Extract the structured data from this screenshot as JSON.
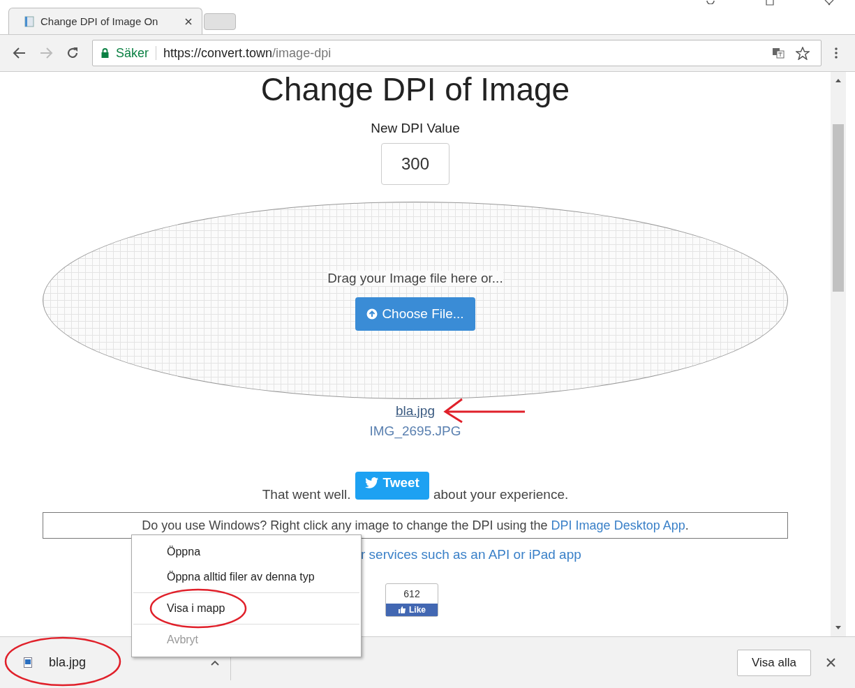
{
  "browser": {
    "tab": {
      "title": "Change DPI of Image On",
      "selected": true
    },
    "address": {
      "security": "Säker",
      "host": "https://convert.town",
      "path": "/image-dpi"
    }
  },
  "page": {
    "title": "Change DPI of Image",
    "dpi_label": "New DPI Value",
    "dpi_value": "300",
    "drop_text": "Drag your Image file here or...",
    "choose_button": "Choose File...",
    "files": [
      {
        "name": "bla.jpg",
        "selected": true
      },
      {
        "name": "IMG_2695.JPG",
        "selected": false
      }
    ],
    "tweet_before": "That went well.",
    "tweet_button": "Tweet",
    "tweet_after": "about your experience.",
    "windows_notice": {
      "text": "Do you use Windows? Right click any image to change the DPI using the",
      "link": "DPI Image Desktop App",
      "end": "."
    },
    "services_link": "r services such as an API or iPad app",
    "like": {
      "count": "612",
      "label": "Like"
    }
  },
  "context_menu": {
    "items": [
      {
        "kind": "item",
        "label": "Öppna",
        "disabled": false
      },
      {
        "kind": "item",
        "label": "Öppna alltid filer av denna typ",
        "disabled": false
      },
      {
        "kind": "separator"
      },
      {
        "kind": "item",
        "label": "Visa i mapp",
        "disabled": false
      },
      {
        "kind": "separator"
      },
      {
        "kind": "item",
        "label": "Avbryt",
        "disabled": true
      }
    ]
  },
  "downloads": {
    "file": "bla.jpg",
    "show_all": "Visa alla"
  }
}
